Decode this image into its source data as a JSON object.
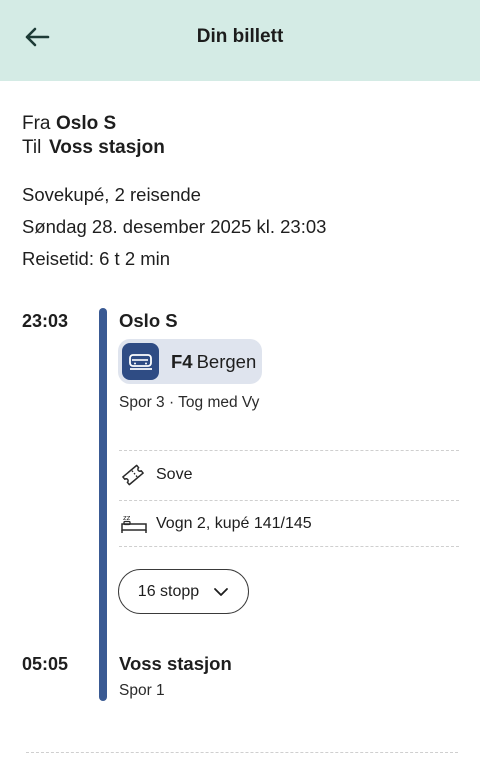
{
  "header": {
    "title": "Din billett"
  },
  "route": {
    "from_label": "Fra",
    "from_station": "Oslo S",
    "to_label": "Til",
    "to_station": "Voss stasjon"
  },
  "trip_info": {
    "ticket_type": "Sovekupé, 2 reisende",
    "datetime": "Søndag 28. desember 2025 kl. 23:03",
    "duration": "Reisetid: 6 t 2 min"
  },
  "departure": {
    "time": "23:03",
    "station": "Oslo S",
    "line_code": "F4",
    "line_name": "Bergen",
    "platform_operator": "Spor 3 · Tog med Vy"
  },
  "details": {
    "service": "Sove",
    "seat": "Vogn 2, kupé 141/145"
  },
  "stops_button": {
    "label": "16 stopp"
  },
  "arrival": {
    "time": "05:05",
    "station": "Voss stasjon",
    "platform": "Spor 1"
  },
  "colors": {
    "header_bg": "#d4ebe5",
    "timeline": "#3a5a93",
    "badge_bg": "#dfe4ee",
    "icon_bg": "#2f4c84"
  }
}
